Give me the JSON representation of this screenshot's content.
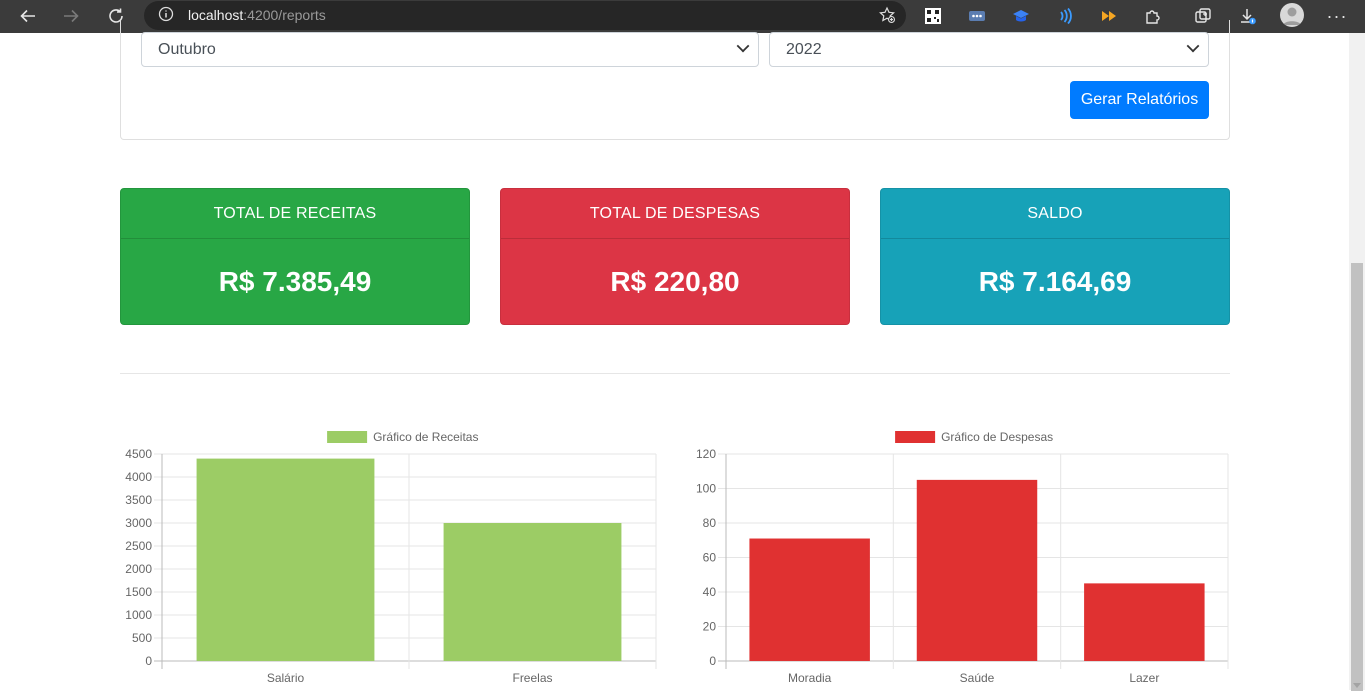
{
  "browser": {
    "url_host": "localhost",
    "url_path": ":4200/reports",
    "extensions": [
      "qr-code-icon",
      "ellipsis-extension-icon",
      "graduation-cap-icon",
      "wireless-icon",
      "fast-forward-icon",
      "puzzle-icon",
      "collections-icon",
      "downloads-icon"
    ]
  },
  "filters": {
    "month": "Outubro",
    "year": "2022",
    "generate_button": "Gerar Relatórios"
  },
  "cards": [
    {
      "title": "TOTAL DE RECEITAS",
      "value": "R$ 7.385,49",
      "color": "#28a745"
    },
    {
      "title": "TOTAL DE DESPESAS",
      "value": "R$ 220,80",
      "color": "#dc3545"
    },
    {
      "title": "SALDO",
      "value": "R$ 7.164,69",
      "color": "#17a2b8"
    }
  ],
  "chart_data": [
    {
      "type": "bar",
      "series": [
        {
          "name": "Gráfico de Receitas",
          "values": [
            4400,
            3000
          ],
          "color": "#9ccc65"
        }
      ],
      "categories": [
        "Salário",
        "Freelas"
      ],
      "ylim": [
        0,
        4500
      ],
      "yticks": [
        0,
        500,
        1000,
        1500,
        2000,
        2500,
        3000,
        3500,
        4000,
        4500
      ],
      "grid": true,
      "legend": "top"
    },
    {
      "type": "bar",
      "series": [
        {
          "name": "Gráfico de Despesas",
          "values": [
            71,
            105,
            45
          ],
          "color": "#e03131"
        }
      ],
      "categories": [
        "Moradia",
        "Saúde",
        "Lazer"
      ],
      "ylim": [
        0,
        120
      ],
      "yticks": [
        0,
        20,
        40,
        60,
        80,
        100,
        120
      ],
      "grid": true,
      "legend": "top"
    }
  ]
}
